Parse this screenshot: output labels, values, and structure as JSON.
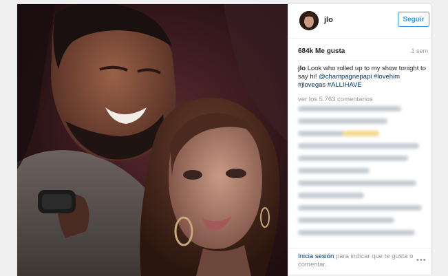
{
  "post": {
    "username": "jlo",
    "follow_label": "Seguir",
    "likes": "684k Me gusta",
    "time_ago": "1 sem",
    "caption": {
      "username": "jlo",
      "text": "Look who rolled up to my show tonight to say hi!",
      "mention": "@champagnepapi",
      "hashtags": [
        "#lovehim",
        "#jlovegas",
        "#ALLIHAVE"
      ]
    },
    "view_comments": "ver los 5.763 comentarios",
    "login_link": "Inicia sesión",
    "login_rest": "para indicar que te gusta o comentar.",
    "more_icon": "ellipsis-icon"
  },
  "colors": {
    "follow_blue": "#3897f0",
    "link_navy": "#003569",
    "muted": "#999999"
  }
}
